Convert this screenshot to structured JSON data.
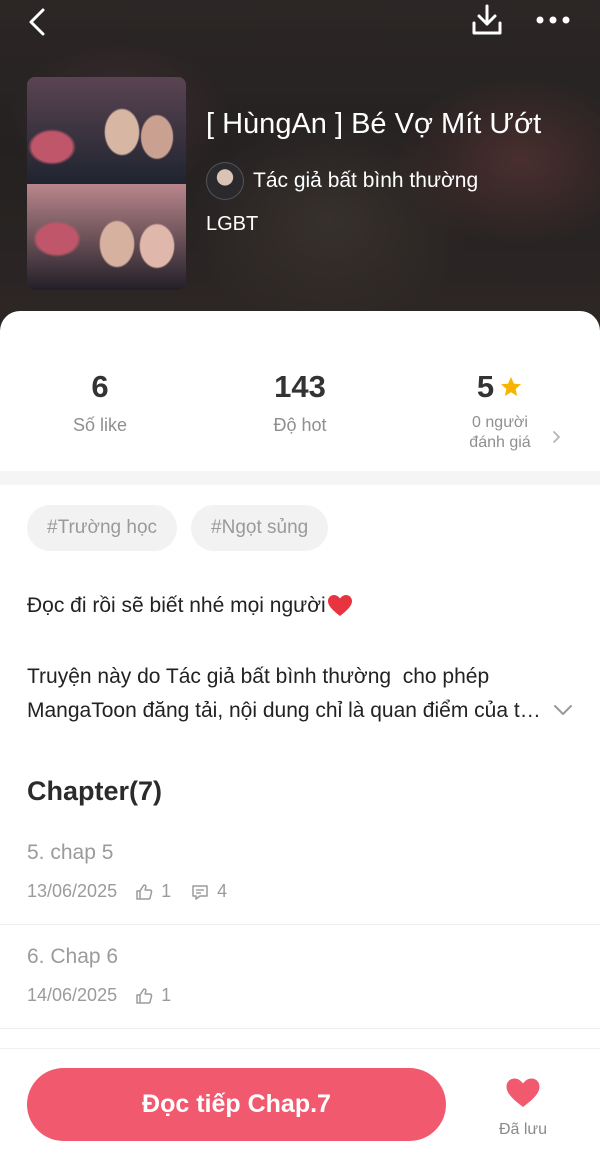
{
  "header": {
    "title": "[ HùngAn ] Bé Vợ Mít Ướt",
    "author": "Tác giả bất bình thường",
    "genre": "LGBT",
    "icons": {
      "back": "back-arrow-icon",
      "download": "download-icon",
      "more": "more-dots-icon"
    }
  },
  "stats": {
    "likes": {
      "value": "6",
      "label": "Số like"
    },
    "hot": {
      "value": "143",
      "label": "Độ hot"
    },
    "rating": {
      "value": "5",
      "label_line1": "0 người",
      "label_line2": "đánh giá"
    }
  },
  "tags": [
    "#Trường học",
    "#Ngọt sủng"
  ],
  "description": {
    "line1": "Đọc đi rồi sẽ biết nhé mọi người",
    "line2": "Truyện này do Tác giả bất bình thường  cho phép",
    "line3": "MangaToon đăng tải, nội dung chỉ là quan điểm của tác giả"
  },
  "chapters": {
    "heading": "Chapter(7)",
    "items": [
      {
        "name": "5. chap 5",
        "date": "13/06/2025",
        "likes": "1",
        "comments": "4"
      },
      {
        "name": "6. Chap 6",
        "date": "14/06/2025",
        "likes": "1"
      }
    ]
  },
  "footer": {
    "read_button": "Đọc tiếp Chap.7",
    "save_label": "Đã lưu"
  },
  "colors": {
    "accent": "#f15a6e",
    "star": "#f7b500",
    "heart": "#f15a6e"
  }
}
